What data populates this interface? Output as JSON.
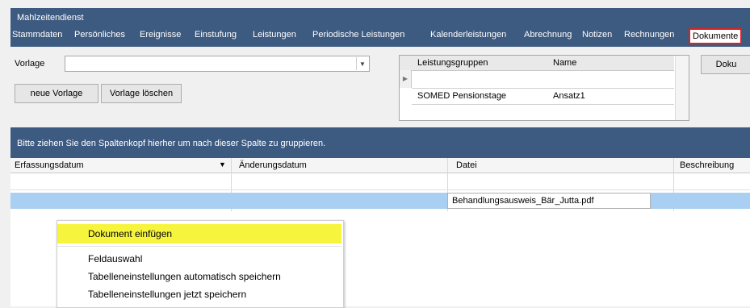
{
  "app": {
    "title": "Mahlzeitendienst"
  },
  "menu": [
    {
      "label": "Stammdaten"
    },
    {
      "label": "Persönliches"
    },
    {
      "label": "Ereignisse"
    },
    {
      "label": "Einstufung"
    },
    {
      "label": "Leistungen"
    },
    {
      "label": "Periodische Leistungen"
    },
    {
      "label": "Kalenderleistungen"
    },
    {
      "label": "Abrechnung"
    },
    {
      "label": "Notizen"
    },
    {
      "label": "Rechnungen"
    },
    {
      "label": "Dokumente"
    }
  ],
  "form": {
    "vorlage_label": "Vorlage",
    "vorlage_value": "",
    "new_template_btn": "neue Vorlage",
    "delete_template_btn": "Vorlage löschen",
    "doku_btn": "Doku"
  },
  "leistungsgruppen": {
    "columns": [
      "Leistungsgruppen",
      "Name"
    ],
    "rows": [
      {
        "group": "SOMED Pensionstage",
        "name": "Ansatz1"
      }
    ]
  },
  "group_hint": "Bitte ziehen Sie den Spaltenkopf hierher um nach dieser Spalte zu gruppieren.",
  "table": {
    "columns": [
      "Erfassungsdatum",
      "Änderungsdatum",
      "Datei",
      "Beschreibung"
    ],
    "rows": [
      {
        "datei": "Behandlungsausweis_Bär_Jutta.pdf"
      }
    ]
  },
  "context_menu": {
    "items": [
      {
        "label": "Dokument einfügen",
        "highlighted": true
      },
      {
        "label": "Feldauswahl"
      },
      {
        "label": "Tabelleneinstellungen automatisch speichern"
      },
      {
        "label": "Tabelleneinstellungen jetzt speichern"
      }
    ]
  },
  "colors": {
    "header": "#3d5a80",
    "selection": "#a9cff2",
    "highlight": "#f6f43c",
    "active_border": "#e0201c"
  }
}
